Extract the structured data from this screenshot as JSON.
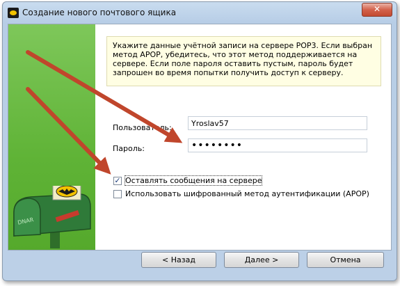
{
  "window": {
    "title": "Создание нового почтового ящика",
    "close_label": "✕"
  },
  "info": {
    "text": "Укажите данные учётной записи на сервере POP3. Если выбран метод APOP, убедитесь, что этот метод поддерживается на сервере. Если поле пароля оставить пустым, пароль будет запрошен во время попытки получить доступ к серверу."
  },
  "form": {
    "username_label": "Пользователь:",
    "username_value": "Yroslav57",
    "password_label": "Пароль:",
    "password_value": "••••••••"
  },
  "options": {
    "leave_on_server_label": "Оставлять сообщения на сервере",
    "leave_on_server_checked": true,
    "leave_on_server_mark": "✓",
    "apop_label": "Использовать шифрованный метод аутентификации (APOP)",
    "apop_checked": false
  },
  "buttons": {
    "back_label": "<  Назад",
    "next_label": "Далее  >",
    "cancel_label": "Отмена"
  },
  "illustration": {
    "mailbox_text": "DNAR"
  },
  "colors": {
    "side_panel": "#5fb336",
    "info_background": "#fffee3",
    "annotation_arrow": "#c0462c"
  }
}
